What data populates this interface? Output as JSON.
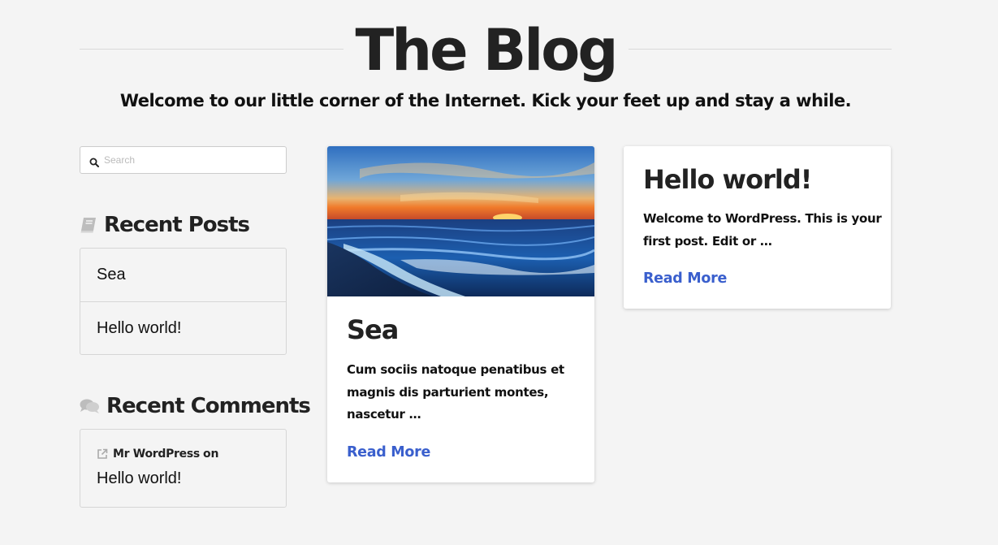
{
  "site": {
    "title": "The Blog",
    "tagline": "Welcome to our little corner of the Internet. Kick your feet up and stay a while."
  },
  "search": {
    "placeholder": "Search",
    "value": "",
    "icon": "search-icon"
  },
  "recent_posts": {
    "title": "Recent Posts",
    "icon": "book-icon",
    "items": [
      {
        "label": "Sea"
      },
      {
        "label": "Hello world!"
      }
    ]
  },
  "recent_comments": {
    "title": "Recent Comments",
    "icon": "comments-icon",
    "items": [
      {
        "author": "Mr WordPress",
        "on": "on",
        "post": "Hello world!",
        "icon": "external-link-icon"
      }
    ]
  },
  "posts": [
    {
      "title": "Sea",
      "excerpt_lines": [
        "Cum sociis natoque penatibus et",
        "magnis dis parturient montes,",
        "nascetur …"
      ],
      "read_more": "Read More",
      "has_image": true
    },
    {
      "title": "Hello world!",
      "excerpt_lines": [
        "Welcome to WordPress. This is your",
        "first post. Edit or …"
      ],
      "read_more": "Read More",
      "has_image": false
    }
  ],
  "colors": {
    "background": "#f4f4f4",
    "link": "#3a5fcd",
    "text": "#222222",
    "border": "#d6d6d6"
  }
}
